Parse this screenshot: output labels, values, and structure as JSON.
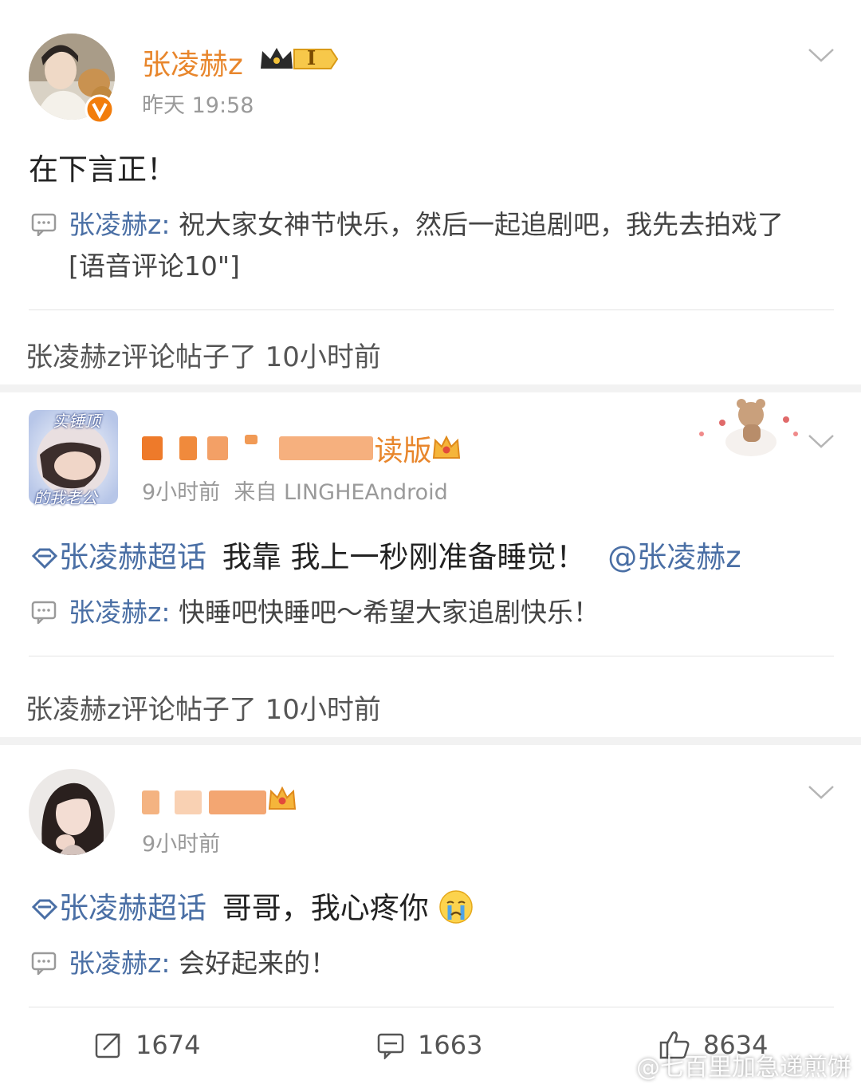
{
  "posts": [
    {
      "username": "张凌赫z",
      "badge_level": "I",
      "time": "昨天 19:58",
      "text": "在下言正！",
      "reply": {
        "name": "张凌赫z:",
        "text": "祝大家女神节快乐，然后一起追剧吧，我先去拍戏了",
        "extra": "[语音评论10\"]"
      }
    },
    {
      "username": "读版",
      "time": "9小时前",
      "source": "来自 LINGHEAndroid",
      "avatar_text_top": "实锤顶",
      "avatar_text_bottom": "的我老公",
      "topic": "张凌赫超话",
      "text": "我靠 我上一秒刚准备睡觉！",
      "mention": "@张凌赫z",
      "reply": {
        "name": "张凌赫z:",
        "text": "快睡吧快睡吧～希望大家追剧快乐！"
      }
    },
    {
      "username": "",
      "time": "9小时前",
      "topic": "张凌赫超话",
      "text": "哥哥，我心疼你",
      "reply": {
        "name": "张凌赫z:",
        "text": "会好起来的！"
      }
    }
  ],
  "activity_lines": [
    "张凌赫z评论帖子了 10小时前",
    "张凌赫z评论帖子了 10小时前"
  ],
  "actions": {
    "repost": "1674",
    "comment": "1663",
    "like": "8634"
  },
  "watermark": "@七百里加急递煎饼",
  "colors": {
    "username": "#e8862c",
    "link": "#4a6fa5",
    "separator": "#f2f2f2"
  }
}
